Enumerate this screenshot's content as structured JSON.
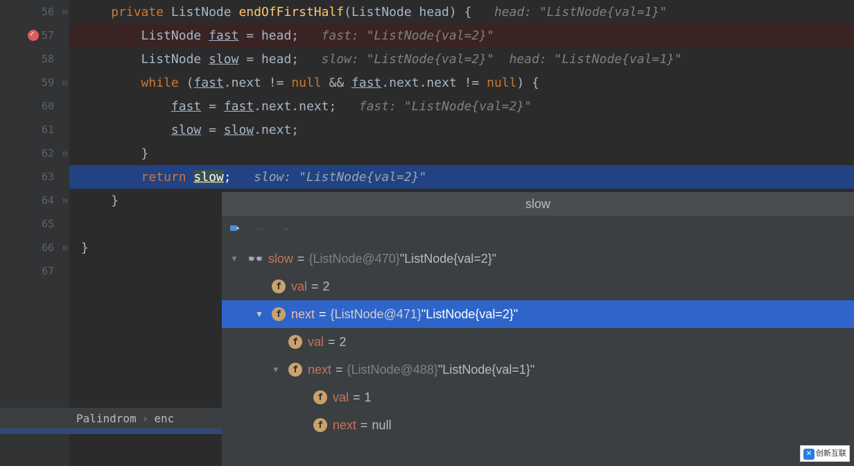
{
  "lines": {
    "56": {
      "num": "56",
      "indent": "     ",
      "kw1": "private",
      "type1": "ListNode",
      "method": "endOfFirstHalf",
      "paren_open": "(",
      "type2": "ListNode",
      "param": "head",
      "paren_close": ")",
      "brace": " {",
      "hint": "   head: \"ListNode{val=1}\""
    },
    "57": {
      "num": "57",
      "indent": "         ",
      "type": "ListNode ",
      "var": "fast",
      "rest": " = head;",
      "hint": "   fast: \"ListNode{val=2}\""
    },
    "58": {
      "num": "58",
      "indent": "         ",
      "type": "ListNode ",
      "var": "slow",
      "rest": " = head;",
      "hint1": "   slow: \"ListNode{val=2}\"",
      "hint2": "  head: \"ListNode{val=1}\""
    },
    "59": {
      "num": "59",
      "indent": "         ",
      "kw": "while",
      "p1": " (",
      "v1": "fast",
      "p2": ".next != ",
      "null1": "null",
      "p3": " && ",
      "v2": "fast",
      "p4": ".next.next != ",
      "null2": "null",
      "p5": ") {"
    },
    "60": {
      "num": "60",
      "indent": "             ",
      "v1": "fast",
      "eq": " = ",
      "v2": "fast",
      "rest": ".next.next;",
      "hint": "   fast: \"ListNode{val=2}\""
    },
    "61": {
      "num": "61",
      "indent": "             ",
      "v1": "slow",
      "eq": " = ",
      "v2": "slow",
      "rest": ".next;"
    },
    "62": {
      "num": "62",
      "indent": "         ",
      "brace": "}"
    },
    "63": {
      "num": "63",
      "indent": "         ",
      "kw": "return",
      "sp": " ",
      "var": "slow",
      "semi": ";",
      "hint": "   slow: \"ListNode{val=2}\""
    },
    "64": {
      "num": "64",
      "indent": "     ",
      "brace": "}"
    },
    "65": {
      "num": "65"
    },
    "66": {
      "num": "66",
      "indent": " ",
      "brace": "}"
    },
    "67": {
      "num": "67"
    }
  },
  "breadcrumb": {
    "item1": "Palindrom",
    "item2": "enc"
  },
  "debug": {
    "title": "slow",
    "tree": [
      {
        "name": "slow",
        "eq": " = ",
        "obj": "{ListNode@470} ",
        "str": "\"ListNode{val=2}\""
      },
      {
        "name": "val",
        "eq": " = ",
        "val": "2"
      },
      {
        "name": "next",
        "eq": " = ",
        "obj": "{ListNode@471} ",
        "str": "\"ListNode{val=2}\""
      },
      {
        "name": "val",
        "eq": " = ",
        "val": "2"
      },
      {
        "name": "next",
        "eq": " = ",
        "obj": "{ListNode@488} ",
        "str": "\"ListNode{val=1}\""
      },
      {
        "name": "val",
        "eq": " = ",
        "val": "1"
      },
      {
        "name": "next",
        "eq": " = ",
        "val": "null"
      }
    ]
  },
  "watermark": "创新互联"
}
